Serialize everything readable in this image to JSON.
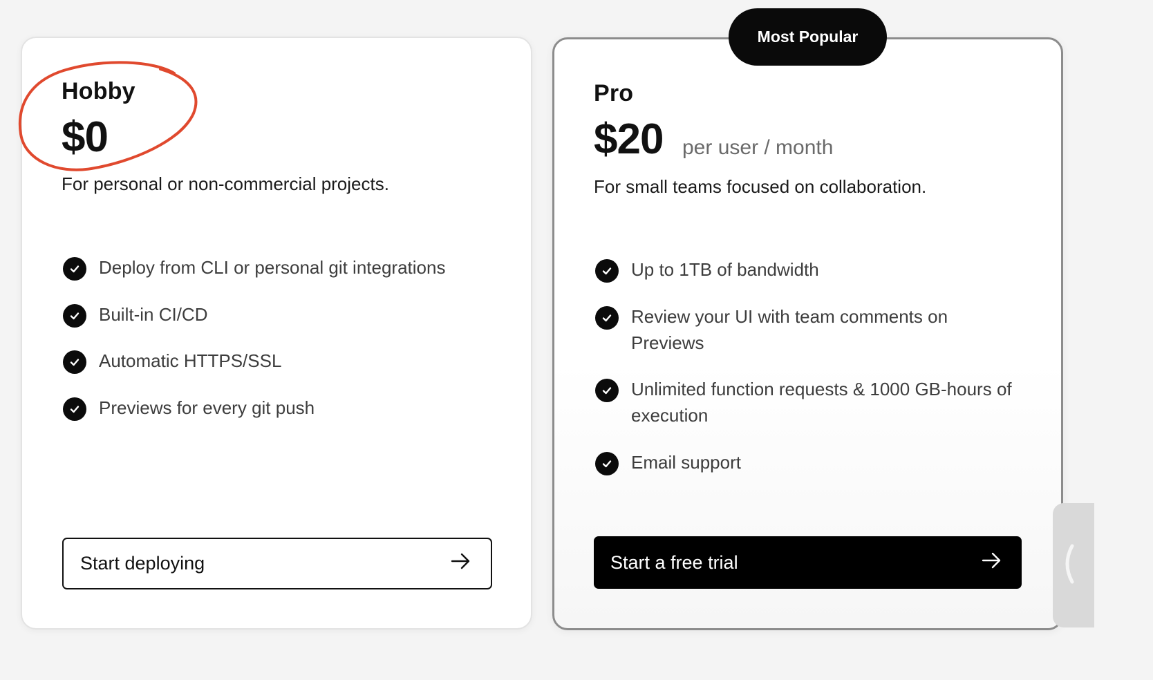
{
  "colors": {
    "page_background": "#f4f4f4",
    "card_background": "#ffffff",
    "accent_dark": "#000000",
    "annotation_circle": "#e0492e",
    "muted_text": "#6a6a6a"
  },
  "badge": {
    "label": "Most Popular"
  },
  "plans": [
    {
      "name": "Hobby",
      "price": "$0",
      "price_unit": "",
      "description": "For personal or non-commercial projects.",
      "features": [
        "Deploy from CLI or personal git integrations",
        "Built-in CI/CD",
        "Automatic HTTPS/SSL",
        "Previews for every git push"
      ],
      "cta_label": "Start deploying",
      "cta_icon": "arrow-right-icon"
    },
    {
      "name": "Pro",
      "price": "$20",
      "price_unit": "per user / month",
      "description": "For small teams focused on collaboration.",
      "features": [
        "Up to 1TB of bandwidth",
        "Review your UI with team comments on Previews",
        "Unlimited function requests & 1000 GB-hours of execution",
        "Email support"
      ],
      "cta_label": "Start a free trial",
      "cta_icon": "arrow-right-icon"
    }
  ],
  "icons": {
    "feature_bullet": "check-circle-icon",
    "side_tab": "chevron-left-icon",
    "annotation": "hand-drawn-circle"
  }
}
